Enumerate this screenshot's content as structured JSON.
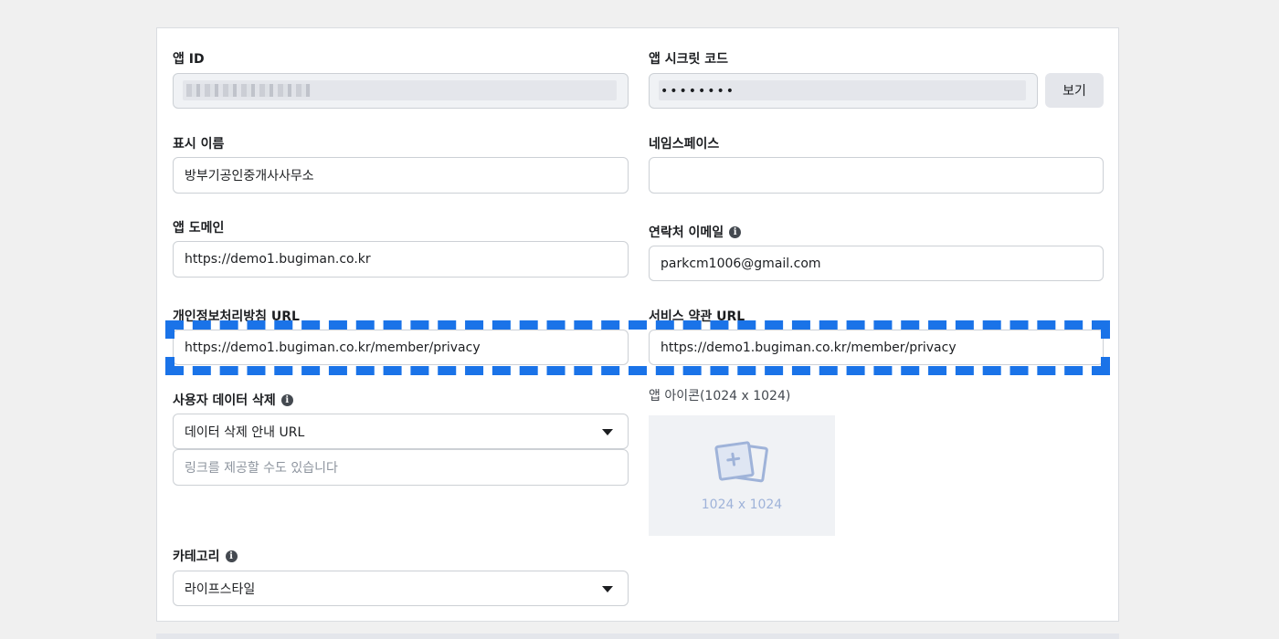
{
  "colors": {
    "accent": "#1a73e8",
    "border": "#ccd0d5",
    "disabled_bg": "#f0f2f5"
  },
  "app_id": {
    "label": "앱 ID"
  },
  "app_secret": {
    "label": "앱 시크릿 코드",
    "value": "••••••••",
    "show_button": "보기"
  },
  "display_name": {
    "label": "표시 이름",
    "value": "방부기공인중개사사무소"
  },
  "namespace": {
    "label": "네임스페이스",
    "value": ""
  },
  "app_domain": {
    "label": "앱 도메인",
    "value": "https://demo1.bugiman.co.kr"
  },
  "contact_email": {
    "label": "연락처 이메일",
    "value": "parkcm1006@gmail.com",
    "info_icon": "info-icon"
  },
  "privacy_url": {
    "label": "개인정보처리방침 URL",
    "value": "https://demo1.bugiman.co.kr/member/privacy"
  },
  "terms_url": {
    "label": "서비스 약관 URL",
    "value": "https://demo1.bugiman.co.kr/member/privacy"
  },
  "data_deletion": {
    "label": "사용자 데이터 삭제",
    "selected": "데이터 삭제 안내 URL",
    "placeholder": "링크를 제공할 수도 있습니다"
  },
  "app_icon": {
    "label": "앱 아이콘(1024 x 1024)",
    "caption": "1024 x 1024"
  },
  "category": {
    "label": "카테고리",
    "selected": "라이프스타일"
  }
}
